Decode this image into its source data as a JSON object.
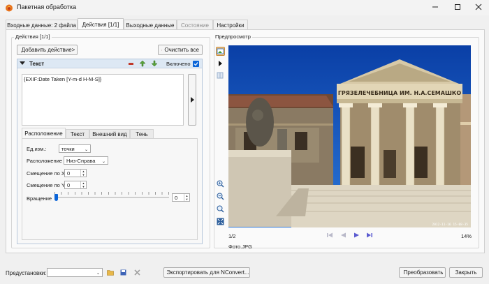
{
  "window": {
    "title": "Пакетная обработка"
  },
  "tabs": [
    {
      "label": "Входные данные: 2 файла",
      "state": "normal"
    },
    {
      "label": "Действия [1/1]",
      "state": "active"
    },
    {
      "label": "Выходные данные",
      "state": "normal"
    },
    {
      "label": "Состояние",
      "state": "disabled"
    },
    {
      "label": "Настройки",
      "state": "normal"
    }
  ],
  "actions": {
    "group_label": "Действия [1/1]",
    "add_button": "Добавить действие>",
    "clear_button": "Очистить все",
    "item": {
      "title": "Текст",
      "enabled_label": "Включено",
      "enabled": true
    },
    "text_content": "{EXIF:Date Taken [Y-m-d H-M-S]}",
    "subtabs": [
      "Расположение",
      "Текст",
      "Внешний вид",
      "Тень"
    ],
    "fields": {
      "units_label": "Ед.изм.:",
      "units_value": "точки",
      "position_label": "Расположение",
      "position_value": "Низ-Справа",
      "offset_x_label": "Смещение по X",
      "offset_x_value": "0",
      "offset_y_label": "Смещение по Y",
      "offset_y_value": "0",
      "rotation_label": "Вращение",
      "rotation_value": "0"
    }
  },
  "preview": {
    "group_label": "Предпросмотр",
    "page": "1/2",
    "zoom": "14%",
    "filename": "Фото.JPG",
    "building_inscription": "ГРЯЗЕЛЕЧЕБНИЦА ИМ. Н.А.СЕМАШКО",
    "photo_timestamp": "2012-11-16 15-08-35"
  },
  "footer": {
    "presets_label": "Предустановки:",
    "export_button": "Экспортировать для NConvert...",
    "convert_button": "Преобразовать",
    "close_button": "Закрыть"
  },
  "colors": {
    "accent": "#0a64d8",
    "item_header": "#dde8f4",
    "sky": "#0d4fb8"
  }
}
